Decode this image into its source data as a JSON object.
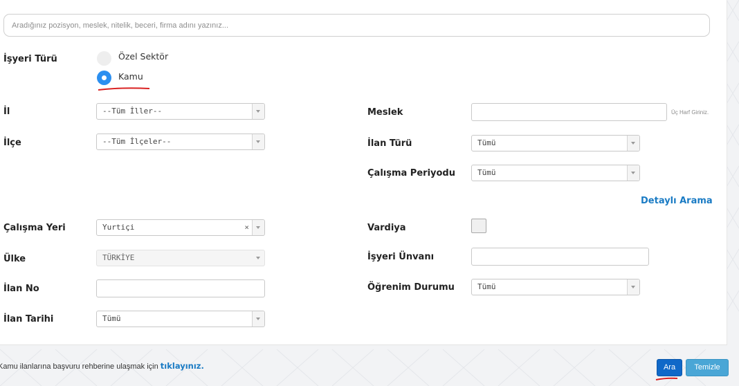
{
  "search": {
    "placeholder": "Aradığınız pozisyon, meslek, nitelik, beceri, firma adını yazınız..."
  },
  "form": {
    "isyeri_turu": {
      "label": "İşyeri Türü",
      "options": [
        "Özel Sektör",
        "Kamu"
      ],
      "selected": "Kamu"
    },
    "il": {
      "label": "İl",
      "value": "--Tüm İller--"
    },
    "ilce": {
      "label": "İlçe",
      "value": "--Tüm İlçeler--"
    },
    "meslek": {
      "label": "Meslek",
      "value": "",
      "hint": "Üç Harf Giriniz."
    },
    "ilan_turu": {
      "label": "İlan Türü",
      "value": "Tümü"
    },
    "calisma_periyodu": {
      "label": "Çalışma Periyodu",
      "value": "Tümü"
    },
    "detayli_arama": "Detaylı Arama",
    "calisma_yeri": {
      "label": "Çalışma Yeri",
      "value": "Yurtiçi",
      "clear": "×"
    },
    "vardiya": {
      "label": "Vardiya",
      "checked": false
    },
    "ulke": {
      "label": "Ülke",
      "value": "TÜRKİYE"
    },
    "isyeri_unvani": {
      "label": "İşyeri Ünvanı",
      "value": ""
    },
    "ilan_no": {
      "label": "İlan No",
      "value": ""
    },
    "ogrenim_durumu": {
      "label": "Öğrenim Durumu",
      "value": "Tümü"
    },
    "ilan_tarihi": {
      "label": "İlan Tarihi",
      "value": "Tümü"
    }
  },
  "footer": {
    "text": "Kamu ilanlarına başvuru rehberine ulaşmak için ",
    "link": "tıklayınız."
  },
  "buttons": {
    "search": "Ara",
    "clear": "Temizle"
  },
  "colors": {
    "accent": "#1a7bc4",
    "radio_selected": "#2b8ff0",
    "annotation": "#d92020"
  }
}
